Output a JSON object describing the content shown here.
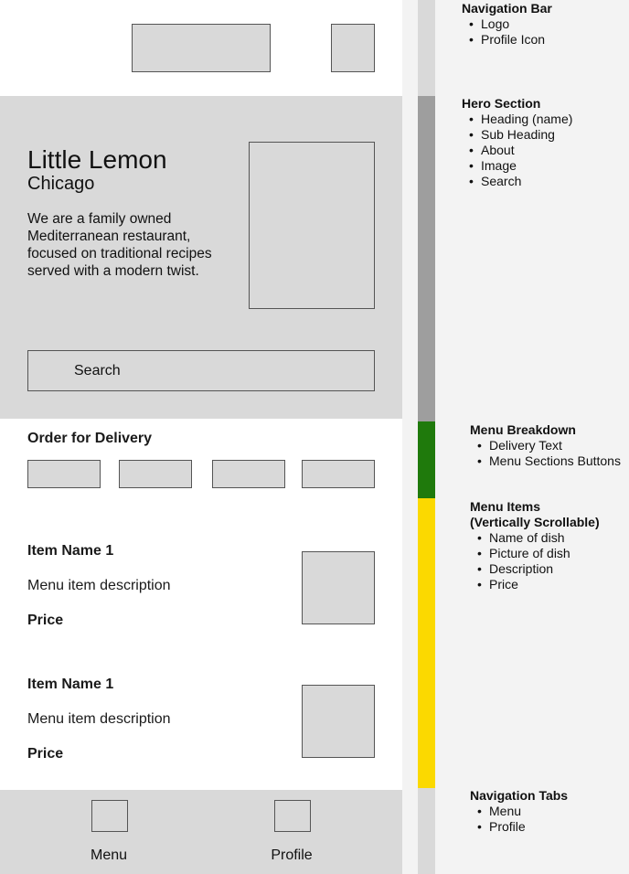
{
  "colors": {
    "wireframe_fill": "#d9d9d9",
    "nav_strip": "#d9d9d9",
    "hero_strip": "#9e9e9e",
    "menu_breakdown_strip": "#1f7a0c",
    "menu_items_strip": "#fbd900",
    "tabs_strip": "#d9d9d9"
  },
  "hero": {
    "title": "Little Lemon",
    "subtitle": "Chicago",
    "about": "We are a family owned Mediterranean restaurant, focused on traditional recipes served with a modern twist.",
    "search_label": "Search"
  },
  "delivery": {
    "title": "Order for Delivery"
  },
  "menu_items": [
    {
      "name": "Item Name 1",
      "description": "Menu item description",
      "price": "Price"
    },
    {
      "name": "Item Name 1",
      "description": "Menu item description",
      "price": "Price"
    }
  ],
  "tabs": [
    {
      "label": "Menu",
      "icon": "menu-tab-icon"
    },
    {
      "label": "Profile",
      "icon": "profile-tab-icon"
    }
  ],
  "annotations": [
    {
      "title": "Navigation Bar",
      "bullets": [
        "Logo",
        "Profile Icon"
      ]
    },
    {
      "title": "Hero Section",
      "bullets": [
        "Heading (name)",
        "Sub Heading",
        "About",
        "Image",
        "Search"
      ]
    },
    {
      "title": "Menu Breakdown",
      "bullets": [
        "Delivery Text",
        "Menu Sections Buttons"
      ]
    },
    {
      "title": "Menu Items",
      "title2": "(Vertically Scrollable)",
      "bullets": [
        "Name of dish",
        "Picture of dish",
        "Description",
        "Price"
      ]
    },
    {
      "title": "Navigation Tabs",
      "bullets": [
        "Menu",
        "Profile"
      ]
    }
  ]
}
